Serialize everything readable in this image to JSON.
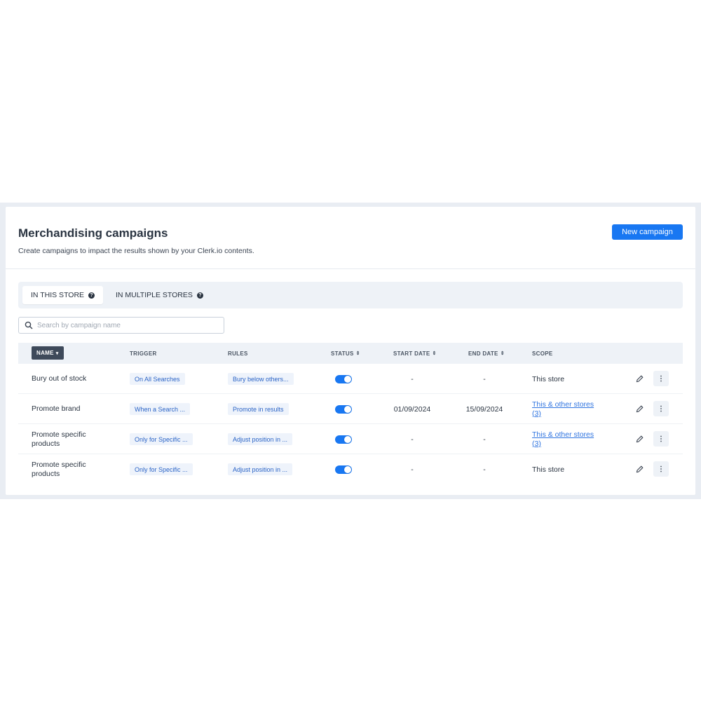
{
  "header": {
    "title": "Merchandising campaigns",
    "subtitle": "Create campaigns to impact the results shown by your Clerk.io contents.",
    "new_button": "New campaign"
  },
  "tabs": [
    {
      "label": "IN THIS STORE",
      "active": true,
      "help_icon": "?"
    },
    {
      "label": "IN MULTIPLE STORES",
      "active": false,
      "help_icon": "?"
    }
  ],
  "search": {
    "placeholder": "Search by campaign name",
    "value": ""
  },
  "table": {
    "columns": {
      "name": "NAME",
      "trigger": "TRIGGER",
      "rules": "RULES",
      "status": "STATUS",
      "start_date": "START DATE",
      "end_date": "END DATE",
      "scope": "SCOPE"
    },
    "sort_down": "▾",
    "sort_both": "⇕",
    "rows": [
      {
        "name": "Bury out of stock",
        "trigger": "On All Searches",
        "rules": "Bury below others...",
        "status": true,
        "start_date": "-",
        "end_date": "-",
        "scope": "This store",
        "scope_link": false
      },
      {
        "name": "Promote brand",
        "trigger": "When a Search ...",
        "rules": "Promote in results",
        "status": true,
        "start_date": "01/09/2024",
        "end_date": "15/09/2024",
        "scope": "This & other stores (3)",
        "scope_link": true
      },
      {
        "name": "Promote specific products",
        "trigger": "Only for Specific ...",
        "rules": "Adjust position in ...",
        "status": true,
        "start_date": "-",
        "end_date": "-",
        "scope": "This & other stores (3)",
        "scope_link": true
      },
      {
        "name": "Promote specific products",
        "trigger": "Only for Specific ...",
        "rules": "Adjust position in ...",
        "status": true,
        "start_date": "-",
        "end_date": "-",
        "scope": "This store",
        "scope_link": false
      }
    ],
    "more_glyph": "⋮"
  },
  "colors": {
    "accent": "#1877f2",
    "link": "#2f74e0",
    "chip_bg": "#eef3fb",
    "chip_text": "#2b64c6",
    "header_bg": "#eef2f7"
  }
}
